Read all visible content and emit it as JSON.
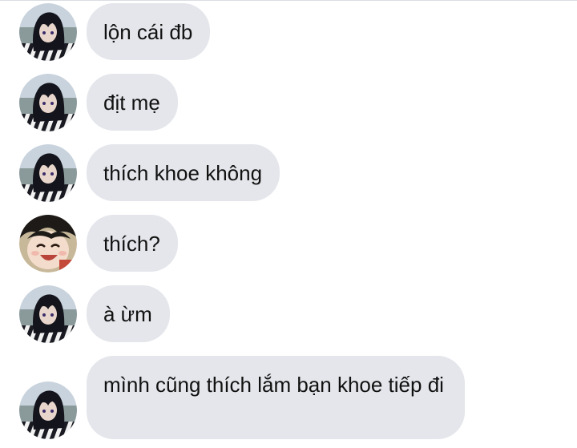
{
  "conversation": {
    "messages": [
      {
        "sender": "friend",
        "avatar": "dark-haired-anime-avatar",
        "text": "lộn cái đb"
      },
      {
        "sender": "friend",
        "avatar": "dark-haired-anime-avatar",
        "text": "địt mẹ"
      },
      {
        "sender": "friend",
        "avatar": "dark-haired-anime-avatar",
        "text": "thích khoe không"
      },
      {
        "sender": "other",
        "avatar": "laughing-anime-avatar",
        "text": "thích?"
      },
      {
        "sender": "friend",
        "avatar": "dark-haired-anime-avatar",
        "text": "à ừm"
      },
      {
        "sender": "friend",
        "avatar": "dark-haired-anime-avatar",
        "text": "mình cũng thích lắm bạn khoe tiếp đi"
      }
    ]
  },
  "colors": {
    "bubble_bg": "#e4e6eb",
    "text": "#111111",
    "background": "#ffffff"
  }
}
